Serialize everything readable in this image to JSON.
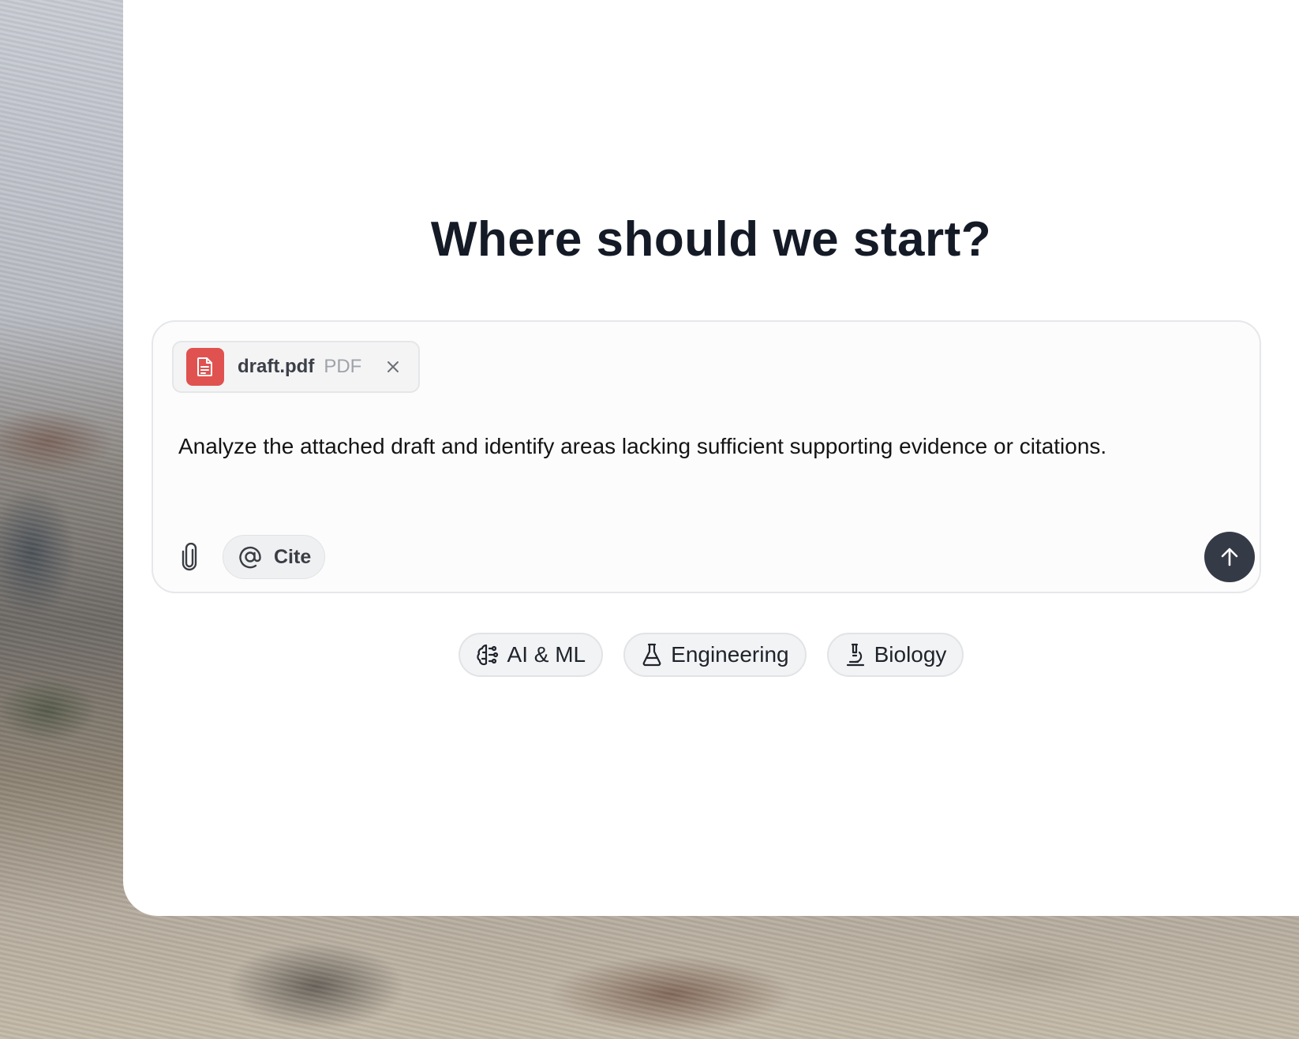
{
  "heading": "Where should we start?",
  "composer": {
    "attachment": {
      "name": "draft.pdf",
      "type": "PDF",
      "icon": "file-text-icon",
      "color": "#e0524f"
    },
    "prompt": "Analyze the attached draft and identify areas lacking sufficient supporting evidence or citations.",
    "attach_icon": "paperclip-icon",
    "cite_label": "Cite",
    "cite_icon": "at-sign-icon",
    "send_icon": "arrow-up-icon"
  },
  "suggestions": [
    {
      "label": "AI & ML",
      "icon": "brain-icon"
    },
    {
      "label": "Engineering",
      "icon": "flask-icon"
    },
    {
      "label": "Biology",
      "icon": "microscope-icon"
    }
  ],
  "colors": {
    "heading": "#141a26",
    "send_button": "#353a47",
    "pdf_badge": "#e0524f"
  }
}
